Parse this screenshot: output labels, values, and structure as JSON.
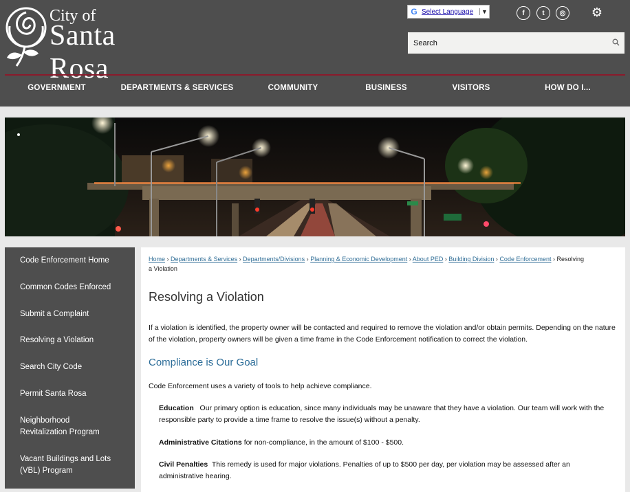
{
  "header": {
    "logo_line1": "City of",
    "logo_line2": "Santa Rosa",
    "translate_label": "Select Language",
    "translate_g": "G",
    "translate_arrow": "▼",
    "social": [
      {
        "name": "facebook-icon",
        "glyph": "f"
      },
      {
        "name": "twitter-icon",
        "glyph": "t"
      },
      {
        "name": "instagram-icon",
        "glyph": "◎"
      }
    ],
    "gear_glyph": "⚙",
    "search_placeholder": "Search",
    "search_icon": "🔍︎"
  },
  "nav": [
    {
      "label": "GOVERNMENT"
    },
    {
      "label": "DEPARTMENTS & SERVICES"
    },
    {
      "label": "COMMUNITY"
    },
    {
      "label": "BUSINESS"
    },
    {
      "label": "VISITORS"
    },
    {
      "label": "HOW DO I..."
    }
  ],
  "sidebar": [
    {
      "label": "Code Enforcement Home"
    },
    {
      "label": "Common Codes Enforced"
    },
    {
      "label": "Submit a Complaint"
    },
    {
      "label": "Resolving a Violation"
    },
    {
      "label": "Search City Code"
    },
    {
      "label": "Permit Santa Rosa"
    },
    {
      "label": "Neighborhood Revitalization Program"
    },
    {
      "label": "Vacant Buildings and Lots (VBL) Program"
    }
  ],
  "breadcrumbs": {
    "items": [
      "Home",
      "Departments & Services",
      "Departments/Divisions",
      "Planning & Economic Development",
      "About PED",
      "Building Division",
      "Code Enforcement"
    ],
    "separator": "›",
    "current": "Resolving a Violation"
  },
  "content": {
    "title": "Resolving a Violation",
    "intro": "If a violation is identified, the property owner will be contacted and required to remove the violation and/or obtain permits. Depending on the nature of the violation, property owners will be given a time frame in the Code Enforcement notification to correct the violation.",
    "subheading": "Compliance is Our Goal",
    "tools_intro": "Code Enforcement uses a variety of tools to help achieve compliance.",
    "education_label": "Education",
    "education_text": "Our primary option is education, since many individuals may be unaware that they have a violation. Our team will work with the responsible party to provide a time frame to resolve the issue(s) without a penalty.",
    "citations_label": "Administrative Citations",
    "citations_text": "for non-compliance, in the amount of $100 - $500.",
    "penalties_label": "Civil Penalties",
    "penalties_text": "This remedy is used for major violations. Penalties of up to $500 per day, per violation may be assessed after an administrative hearing."
  },
  "colors": {
    "header_bg": "#4e4e4e",
    "accent_line": "#8b1a2b",
    "link": "#2f6d96",
    "subheading": "#2b6c98"
  }
}
